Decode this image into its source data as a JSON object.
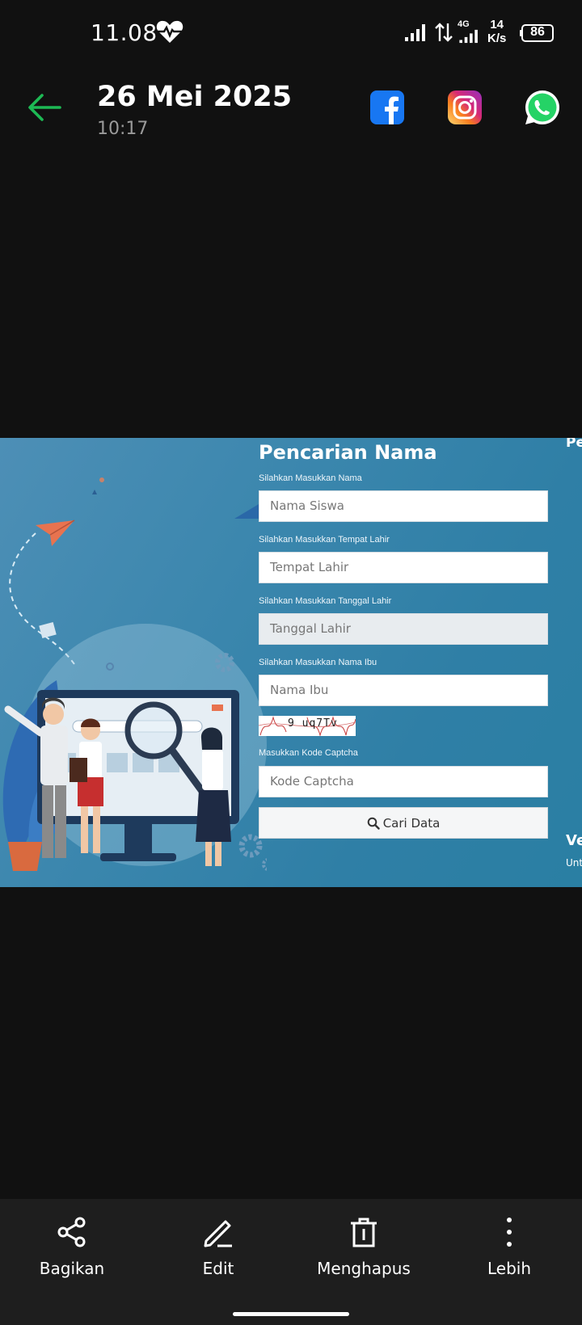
{
  "status_bar": {
    "time": "11.08",
    "network": "4G",
    "speed_value": "14",
    "speed_unit": "K/s",
    "battery": "86"
  },
  "header": {
    "date": "26 Mei 2025",
    "time": "10:17",
    "share_apps": [
      "facebook",
      "instagram",
      "whatsapp"
    ]
  },
  "photo": {
    "form": {
      "title": "Pencarian Nama",
      "fields": [
        {
          "label": "Silahkan Masukkan Nama",
          "placeholder": "Nama Siswa"
        },
        {
          "label": "Silahkan Masukkan Tempat Lahir",
          "placeholder": "Tempat Lahir"
        },
        {
          "label": "Silahkan Masukkan Tanggal Lahir",
          "placeholder": "Tanggal Lahir"
        },
        {
          "label": "Silahkan Masukkan Nama Ibu",
          "placeholder": "Nama Ibu"
        }
      ],
      "captcha_text": "9 uq7Tv",
      "captcha_label": "Masukkan Kode Captcha",
      "captcha_placeholder": "Kode Captcha",
      "button_label": "Cari Data"
    },
    "edge_texts": [
      "Pe",
      "Ve",
      "Unt"
    ]
  },
  "bottom_bar": {
    "actions": [
      {
        "label": "Bagikan",
        "icon": "share-icon"
      },
      {
        "label": "Edit",
        "icon": "pencil-icon"
      },
      {
        "label": "Menghapus",
        "icon": "trash-icon"
      },
      {
        "label": "Lebih",
        "icon": "more-vertical-icon"
      }
    ]
  },
  "colors": {
    "background": "#111111",
    "accent_green": "#1db954",
    "bottom_bar": "#1e1e1e",
    "photo_blue": "#3a86ad"
  }
}
